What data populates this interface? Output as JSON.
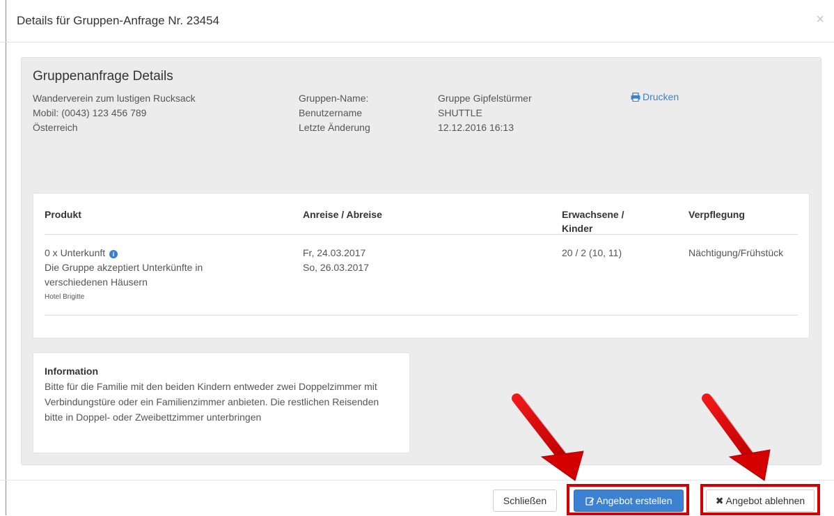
{
  "modal": {
    "title": "Details für Gruppen-Anfrage Nr. 23454",
    "close_glyph": "×"
  },
  "details": {
    "heading": "Gruppenanfrage Details",
    "contact_lines": [
      "Wanderverein zum lustigen Rucksack",
      "Mobil: (0043) 123 456 789",
      "Österreich"
    ],
    "field_labels": [
      "Gruppen-Name:",
      "Benutzername",
      "Letzte Änderung"
    ],
    "field_values": [
      "Gruppe Gipfelstürmer",
      "SHUTTLE",
      "12.12.2016 16:13"
    ],
    "print_label": "Drucken"
  },
  "table": {
    "headers": {
      "product": "Produkt",
      "dates": "Anreise / Abreise",
      "guests_1": "Erwachsene /",
      "guests_2": "Kinder",
      "board": "Verpflegung"
    },
    "row": {
      "product": "0 x Unterkunft",
      "product_note_1": "Die Gruppe akzeptiert Unterkünfte in",
      "product_note_2": "verschiedenen Häusern",
      "hotel": "Hotel Brigitte",
      "arrival": "Fr, 24.03.2017",
      "departure": "So, 26.03.2017",
      "guests": "20 / 2 (10, 11)",
      "board": "Nächtigung/Frühstück"
    }
  },
  "information": {
    "title": "Information",
    "text": "Bitte für die Familie mit den beiden Kindern entweder zwei Doppelzimmer mit Verbindungstüre oder ein Familienzimmer anbieten. Die restlichen Reisenden bitte in Doppel- oder Zweibettzimmer unterbringen"
  },
  "footer": {
    "close_label": "Schließen",
    "create_offer_label": "Angebot erstellen",
    "decline_offer_label": "Angebot ablehnen"
  },
  "colors": {
    "primary": "#3c82d0",
    "highlight": "#d40000",
    "link": "#3a7fd0"
  }
}
